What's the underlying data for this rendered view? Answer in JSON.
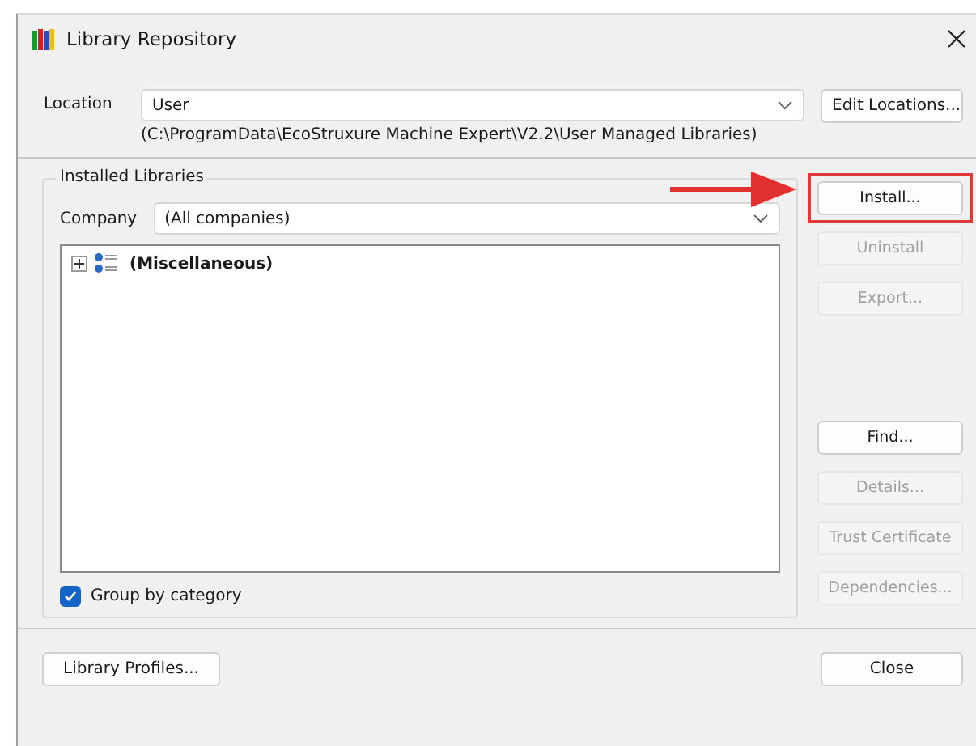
{
  "window": {
    "title": "Library Repository"
  },
  "location": {
    "label": "Location",
    "value": "User",
    "path": "(C:\\ProgramData\\EcoStruxure Machine Expert\\V2.2\\User Managed Libraries)",
    "button": "Edit Locations..."
  },
  "installed_libraries": {
    "title": "Installed Libraries",
    "company_label": "Company",
    "company_value": "(All companies)",
    "tree": [
      {
        "label": "(Miscellaneous)",
        "expanded": false
      }
    ],
    "group_by_category": {
      "label": "Group by category",
      "checked": true
    }
  },
  "side_buttons_top": [
    {
      "label": "Install...",
      "disabled": false,
      "highlighted": true
    },
    {
      "label": "Uninstall",
      "disabled": true,
      "highlighted": false
    },
    {
      "label": "Export...",
      "disabled": true,
      "highlighted": false
    }
  ],
  "side_buttons_bottom": [
    {
      "label": "Find...",
      "disabled": false,
      "highlighted": false
    },
    {
      "label": "Details...",
      "disabled": true,
      "highlighted": false
    },
    {
      "label": "Trust Certificate",
      "disabled": true,
      "highlighted": false
    },
    {
      "label": "Dependencies...",
      "disabled": true,
      "highlighted": false
    }
  ],
  "footer_buttons": [
    "Library Profiles...",
    "Close"
  ]
}
